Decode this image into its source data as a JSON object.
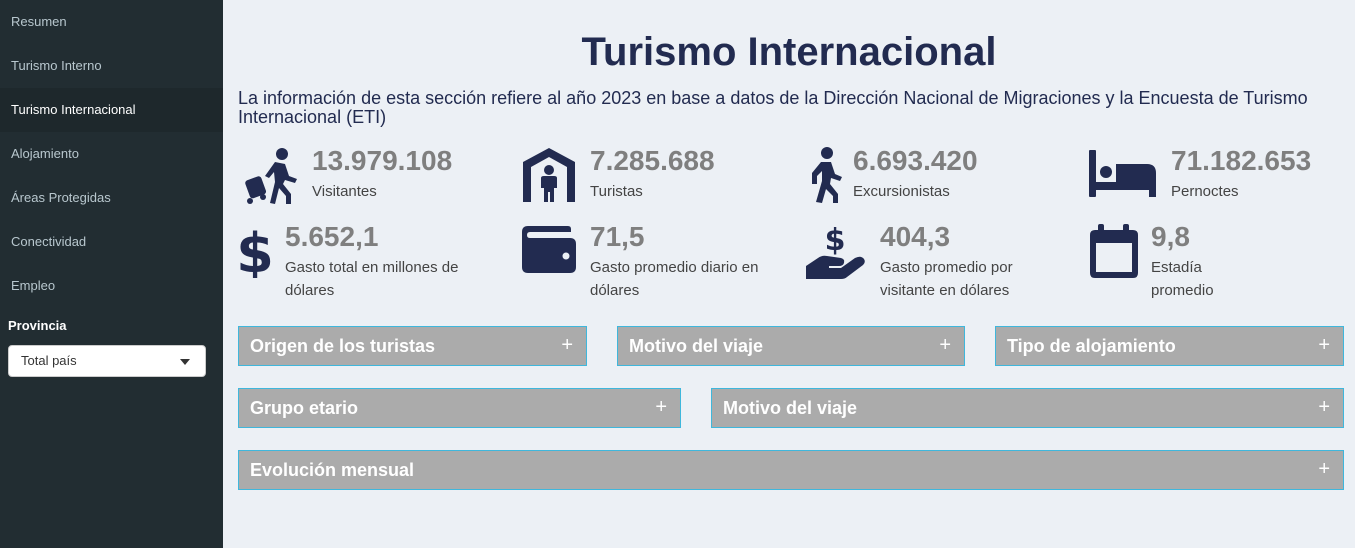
{
  "sidebar": {
    "items": [
      {
        "label": "Resumen"
      },
      {
        "label": "Turismo Interno"
      },
      {
        "label": "Turismo Internacional"
      },
      {
        "label": "Alojamiento"
      },
      {
        "label": "Áreas Protegidas"
      },
      {
        "label": "Conectividad"
      },
      {
        "label": "Empleo"
      }
    ],
    "active_item": "Turismo Internacional",
    "province_label": "Provincia",
    "province_value": "Total país"
  },
  "header": {
    "title": "Turismo Internacional",
    "subtitle": "La información de esta sección refiere al año 2023 en base a datos de la Dirección Nacional de Migraciones y la Encuesta de Turismo Internacional (ETI)"
  },
  "stats": [
    {
      "value": "13.979.108",
      "label": "Visitantes",
      "icon": "person-walking-luggage-icon"
    },
    {
      "value": "7.285.688",
      "label": "Turistas",
      "icon": "person-shelter-icon"
    },
    {
      "value": "6.693.420",
      "label": "Excursionistas",
      "icon": "person-walking-icon"
    },
    {
      "value": "71.182.653",
      "label": "Pernoctes",
      "icon": "bed-icon"
    },
    {
      "value": "5.652,1",
      "label": "Gasto total en millones de dólares",
      "icon": "dollar-sign-icon"
    },
    {
      "value": "71,5",
      "label": "Gasto promedio diario en dólares",
      "icon": "wallet-icon"
    },
    {
      "value": "404,3",
      "label": "Gasto promedio por visitante en dólares",
      "icon": "hand-holding-dollar-icon"
    },
    {
      "value": "9,8",
      "label": "Estadía promedio",
      "icon": "calendar-icon"
    }
  ],
  "boxes": [
    {
      "title": "Origen de los turistas"
    },
    {
      "title": "Motivo del viaje"
    },
    {
      "title": "Tipo de alojamiento"
    },
    {
      "title": "Grupo etario"
    },
    {
      "title": "Motivo del viaje"
    },
    {
      "title": "Evolución mensual"
    }
  ],
  "colors": {
    "sidebar_bg": "#222d32",
    "title_color": "#222b50",
    "box_bg": "#ababab",
    "box_border": "#3fb7dc",
    "icon_color": "#222b50"
  }
}
